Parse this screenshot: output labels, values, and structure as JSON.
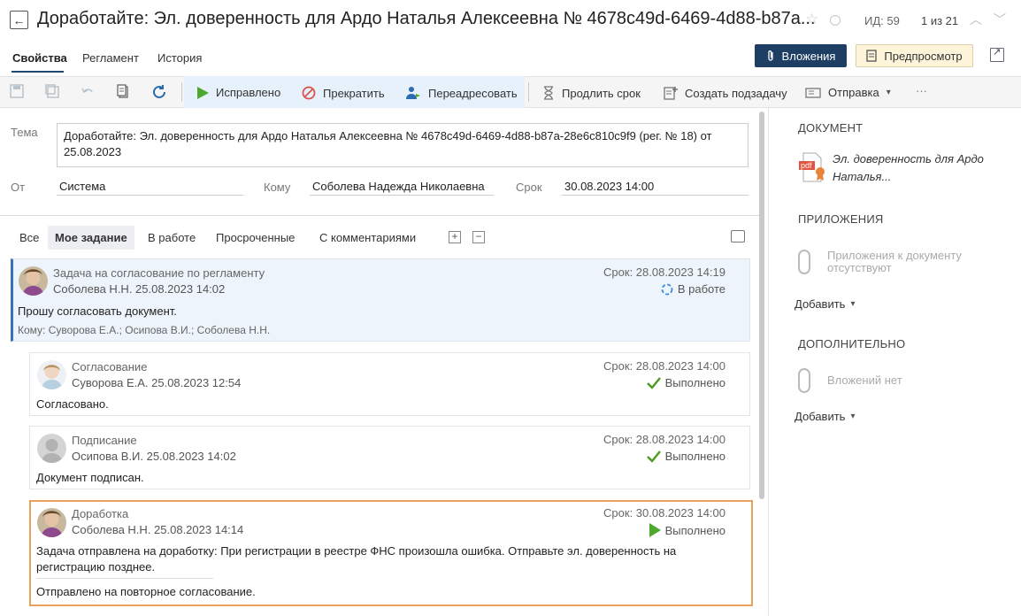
{
  "header": {
    "title": "Доработайте: Эл. доверенность для Ардо Наталья Алексеевна № 4678c49d-6469-4d88-b87a...",
    "id_label": "ИД: 59",
    "pager": "1 из 21"
  },
  "tabs": [
    "Свойства",
    "Регламент",
    "История"
  ],
  "buttons": {
    "attachments": "Вложения",
    "preview": "Предпросмотр"
  },
  "toolbar": {
    "fixed": "Исправлено",
    "stop": "Прекратить",
    "readdress": "Переадресовать",
    "extend": "Продлить срок",
    "subtask": "Создать подзадачу",
    "send": "Отправка",
    "more": "···"
  },
  "fields": {
    "subject_label": "Тема",
    "subject": "Доработайте: Эл. доверенность для Ардо Наталья Алексеевна № 4678c49d-6469-4d88-b87a-28e6c810c9f9 (рег. № 18) от 25.08.2023",
    "from_label": "От",
    "from": "Система",
    "to_label": "Кому",
    "to": "Соболева Надежда Николаевна",
    "due_label": "Срок",
    "due": "30.08.2023 14:00"
  },
  "filters": [
    "Все",
    "Мое задание",
    "В работе",
    "Просроченные",
    "С комментариями"
  ],
  "tasks": [
    {
      "type": "Задача на согласование по регламенту",
      "author": "Соболева Н.Н.  25.08.2023 14:02",
      "due": "Срок: 28.08.2023 14:19",
      "status": "В работе",
      "text": "Прошу согласовать документ.",
      "to": "Кому: Суворова Е.А.; Осипова В.И.; Соболева Н.Н."
    },
    {
      "type": "Согласование",
      "author": "Суворова Е.А.  25.08.2023  12:54",
      "due": "Срок: 28.08.2023 14:00",
      "status": "Выполнено",
      "text": "Согласовано."
    },
    {
      "type": "Подписание",
      "author": "Осипова В.И.  25.08.2023 14:02",
      "due": "Срок: 28.08.2023 14:00",
      "status": "Выполнено",
      "text": "Документ подписан."
    },
    {
      "type": "Доработка",
      "author": "Соболева Н.Н.  25.08.2023 14:14",
      "due": "Срок: 30.08.2023 14:00",
      "status": "Выполнено",
      "text": "Задача отправлена на доработку: При регистрации в реестре ФНС произошла ошибка. Отправьте эл. доверенность на регистрацию позднее.",
      "text2": "Отправлено на повторное согласование."
    }
  ],
  "right_pane": {
    "document_head": "ДОКУМЕНТ",
    "document_name": "Эл. доверенность для Ардо Наталья...",
    "pdf_label": "pdf",
    "attachments_head": "ПРИЛОЖЕНИЯ",
    "attachments_empty": "Приложения к документу отсутствуют",
    "add": "Добавить",
    "extra_head": "ДОПОЛНИТЕЛЬНО",
    "extra_empty": "Вложений нет"
  },
  "colors": {
    "accent": "#1e3e63",
    "highlight_border": "#e8a15a",
    "done_green": "#4c9a1e",
    "active_card": "#eef4fb"
  }
}
